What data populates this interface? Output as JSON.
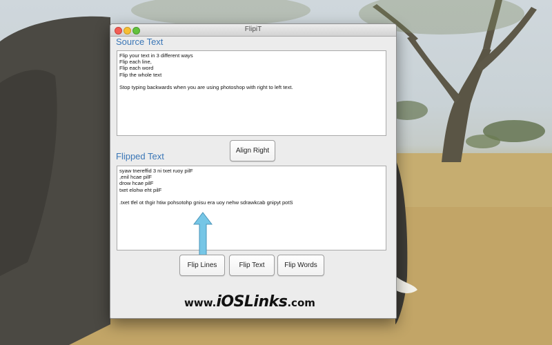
{
  "window": {
    "title": "FlipiT"
  },
  "source": {
    "label": "Source Text",
    "text": "Flip your text in 3 different ways\nFlip each line,\nFlip each word\nFlip the whole text\n\nStop typing backwards when you are using photoshop with right to left text."
  },
  "buttons": {
    "align_right": "Align Right",
    "flip_lines": "Flip Lines",
    "flip_text": "Flip Text",
    "flip_words": "Flip Words"
  },
  "flipped": {
    "label": "Flipped Text",
    "text": "syaw tnereffid 3 ni txet ruoy pilF\n,enil hcae pilF\ndrow hcae pilF\ntxet elohw eht pilF\n\n.txet tfel ot thgir htiw pohsotohp gnisu era uoy nehw sdrawkcab gnipyt potS"
  },
  "watermark": {
    "prefix": "www.",
    "brand": "iOSLinks",
    "suffix": ".com"
  },
  "colors": {
    "section_label": "#3a76b6",
    "arrow": "#76c6e6"
  },
  "icons": [
    "close-button-icon",
    "minimize-button-icon",
    "zoom-button-icon",
    "up-arrow-icon"
  ]
}
